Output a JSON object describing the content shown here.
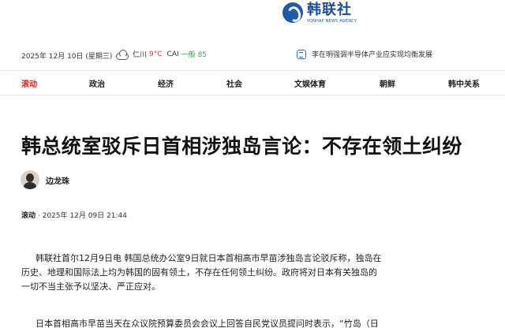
{
  "brand": {
    "name_cn": "韩联社",
    "name_en": "YONHAP NEWS AGENCY"
  },
  "infobar": {
    "date": "2025年 12月 10日 (星期三)",
    "weather": {
      "icon": "cloud-icon",
      "location": "仁川",
      "temperature": "9°C",
      "cai_label": "CAI",
      "cai_value": "一般 85"
    },
    "ticker": {
      "icon": "news-icon",
      "text": "李在明强调半导体产业应实现均衡发展"
    }
  },
  "nav": {
    "items": [
      {
        "label": "滚动",
        "active": true
      },
      {
        "label": "政治",
        "active": false
      },
      {
        "label": "经济",
        "active": false
      },
      {
        "label": "社会",
        "active": false
      },
      {
        "label": "文娱体育",
        "active": false
      },
      {
        "label": "朝鲜",
        "active": false
      },
      {
        "label": "韩中关系",
        "active": false
      }
    ]
  },
  "article": {
    "title": "韩总统室驳斥日首相涉独岛言论：不存在领土纠纷",
    "author": "边龙珠",
    "category": "滚动",
    "datetime": "2025年 12月 09日 21:44",
    "paragraphs": [
      {
        "lines": [
          "韩联社首尔12月9日电 韩国总统办公室9日就日本首相高市早苗涉独岛言论驳斥称，独岛在",
          "历史、地理和国际法上均为韩国的固有领土，不存在任何领土纠纷。政府将对日本有关独岛的",
          "一切不当主张予以坚决、严正应对。"
        ]
      },
      {
        "lines": [
          "日本首相高市早苗当天在众议院预算委员会会议上回答自民党议员提问时表示，“竹岛（日"
        ]
      }
    ]
  },
  "colors": {
    "accent": "#d0261b",
    "brand": "#1e4e9c",
    "temp": "#d23b2f",
    "cai": "#3aa04a"
  }
}
